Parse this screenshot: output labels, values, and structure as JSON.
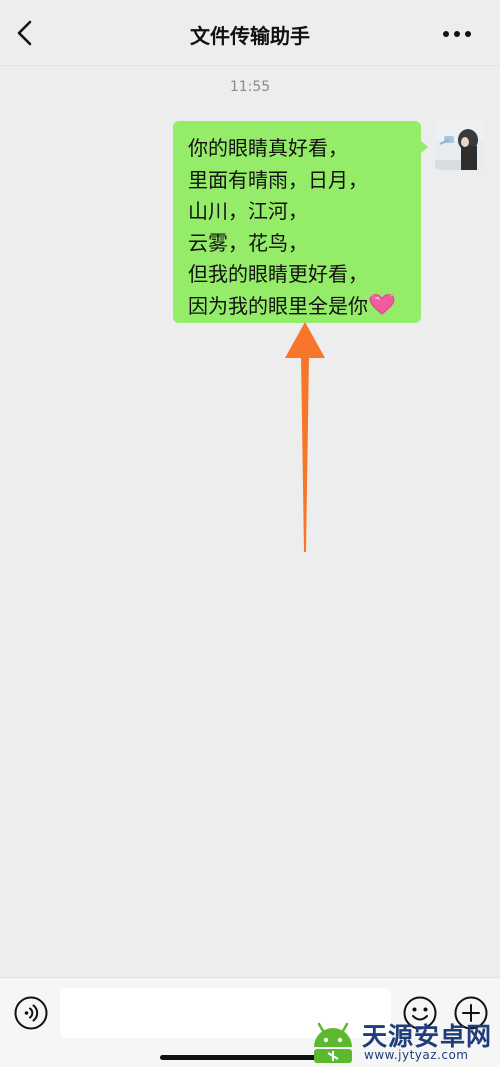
{
  "header": {
    "title": "文件传输助手",
    "back_icon": "chevron-left-icon",
    "more_icon": "more-dots-icon"
  },
  "chat": {
    "timestamp": "11:55",
    "message": {
      "sender": "me",
      "lines": [
        "你的眼睛真好看，",
        "里面有晴雨，日月，",
        "山川，江河，",
        "云雾，花鸟，",
        "但我的眼睛更好看，",
        "因为我的眼里全是你"
      ],
      "trailing_emoji": "heart-emoji",
      "bubble_color": "#95ec69"
    },
    "annotation": {
      "type": "arrow",
      "direction": "up",
      "color": "#f7762a"
    }
  },
  "input_bar": {
    "text_value": "",
    "voice_icon": "voice-icon",
    "emoji_icon": "emoji-icon",
    "plus_icon": "plus-icon"
  },
  "watermark": {
    "text_cn": "天源安卓网",
    "url": "www.jytyaz.com"
  },
  "colors": {
    "background": "#ededed",
    "bubble": "#95ec69",
    "arrow": "#f7762a",
    "watermark": "#1e3d7a"
  }
}
